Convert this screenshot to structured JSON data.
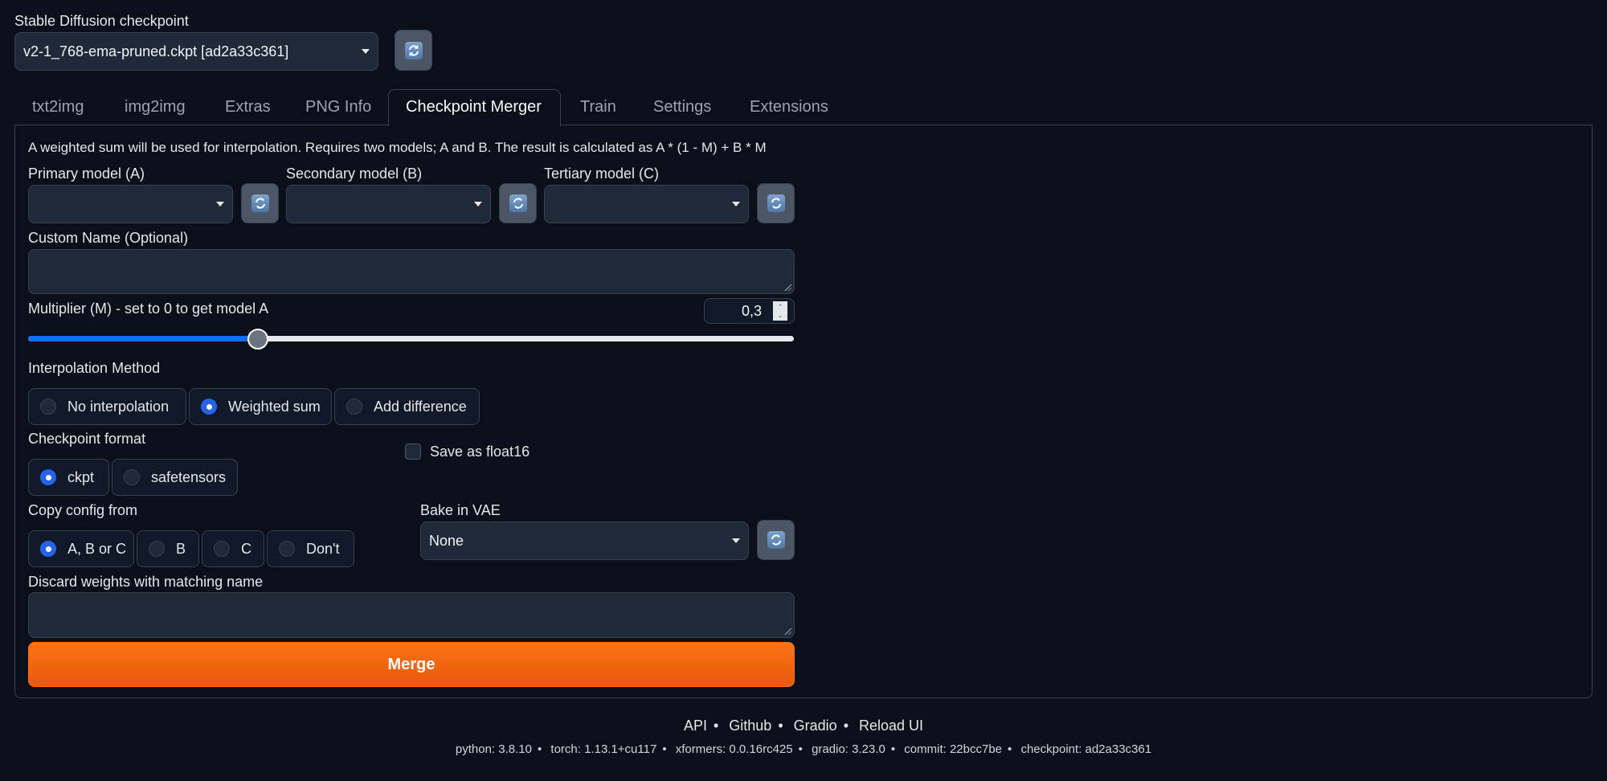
{
  "checkpoint": {
    "label": "Stable Diffusion checkpoint",
    "value": "v2-1_768-ema-pruned.ckpt [ad2a33c361]",
    "refresh_icon": "refresh-icon"
  },
  "tabs": [
    {
      "label": "txt2img",
      "active": false
    },
    {
      "label": "img2img",
      "active": false
    },
    {
      "label": "Extras",
      "active": false
    },
    {
      "label": "PNG Info",
      "active": false
    },
    {
      "label": "Checkpoint Merger",
      "active": true
    },
    {
      "label": "Train",
      "active": false
    },
    {
      "label": "Settings",
      "active": false
    },
    {
      "label": "Extensions",
      "active": false
    }
  ],
  "merger": {
    "description": "A weighted sum will be used for interpolation. Requires two models; A and B. The result is calculated as A * (1 - M) + B * M",
    "primary_label": "Primary model (A)",
    "primary_value": "",
    "secondary_label": "Secondary model (B)",
    "secondary_value": "",
    "tertiary_label": "Tertiary model (C)",
    "tertiary_value": "",
    "custom_name_label": "Custom Name (Optional)",
    "custom_name_value": "",
    "multiplier_label": "Multiplier (M) - set to 0 to get model A",
    "multiplier_value": "0,3",
    "multiplier_fraction": 0.3,
    "interp_label": "Interpolation Method",
    "interp_options": [
      "No interpolation",
      "Weighted sum",
      "Add difference"
    ],
    "interp_selected": "Weighted sum",
    "format_label": "Checkpoint format",
    "format_options": [
      "ckpt",
      "safetensors"
    ],
    "format_selected": "ckpt",
    "float16_label": "Save as float16",
    "float16_checked": false,
    "copy_config_label": "Copy config from",
    "copy_config_options": [
      "A, B or C",
      "B",
      "C",
      "Don't"
    ],
    "copy_config_selected": "A, B or C",
    "bake_vae_label": "Bake in VAE",
    "bake_vae_value": "None",
    "discard_label": "Discard weights with matching name",
    "discard_value": "",
    "merge_button": "Merge"
  },
  "footer": {
    "links": [
      "API",
      "Github",
      "Gradio",
      "Reload UI"
    ],
    "info": [
      "python: 3.8.10",
      "torch: 1.13.1+cu117",
      "xformers: 0.0.16rc425",
      "gradio: 3.23.0",
      "commit: 22bcc7be",
      "checkpoint: ad2a33c361"
    ]
  },
  "colors": {
    "background": "#0b0f19",
    "accent_blue": "#2563eb",
    "slider_fill": "#0d6efd",
    "merge_orange": "#f97316"
  }
}
